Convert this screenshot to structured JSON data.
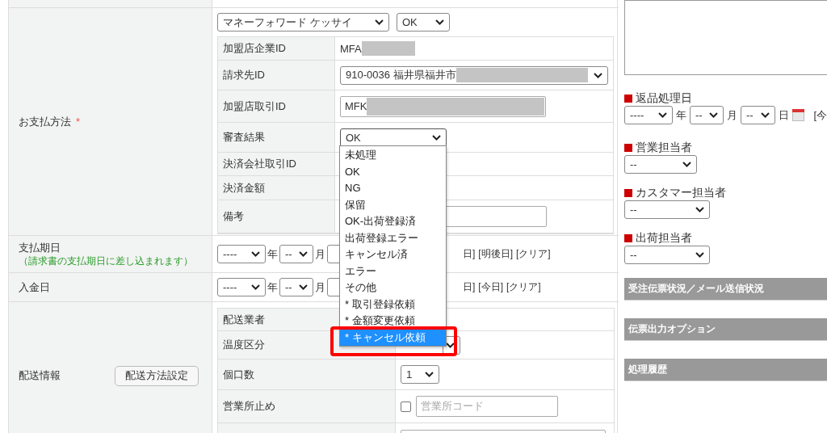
{
  "payment": {
    "label": "お支払方法",
    "required_mark": "*",
    "provider": "マネーフォワード ケッサイ",
    "status": "OK",
    "details": [
      {
        "label": "加盟店企業ID",
        "kind": "text",
        "value": "MFA",
        "redacted": true
      },
      {
        "label": "請求先ID",
        "kind": "select",
        "value": "910-0036 福井県福井市",
        "redacted": true
      },
      {
        "label": "加盟店取引ID",
        "kind": "input",
        "value": "MFK",
        "redacted": true
      },
      {
        "label": "審査結果",
        "kind": "open_select",
        "value": "OK"
      },
      {
        "label": "決済会社取引ID",
        "kind": "empty"
      },
      {
        "label": "決済金額",
        "kind": "empty"
      },
      {
        "label": "備考",
        "kind": "input"
      }
    ]
  },
  "review_dropdown": {
    "options": [
      {
        "label": "未処理",
        "selected": false
      },
      {
        "label": "OK",
        "selected": false
      },
      {
        "label": "NG",
        "selected": false
      },
      {
        "label": "保留",
        "selected": false
      },
      {
        "label": "OK-出荷登録済",
        "selected": false
      },
      {
        "label": "出荷登録エラー",
        "selected": false
      },
      {
        "label": "キャンセル済",
        "selected": false
      },
      {
        "label": "エラー",
        "selected": false
      },
      {
        "label": "その他",
        "selected": false
      },
      {
        "label": "* 取引登録依頼",
        "selected": false
      },
      {
        "label": "* 金額変更依頼",
        "selected": false
      },
      {
        "label": "* キャンセル依頼",
        "selected": true
      }
    ]
  },
  "due_date": {
    "label": "支払期日",
    "note": "（請求書の支払期日に差し込まれます）",
    "year": "----",
    "year_unit": "年",
    "month": "--",
    "month_unit": "月",
    "links": [
      "日]",
      "[明後日]",
      "[クリア]"
    ]
  },
  "deposit_date": {
    "label": "入金日",
    "year": "----",
    "year_unit": "年",
    "month": "--",
    "month_unit": "月",
    "links": [
      "日]",
      "[今日]",
      "[クリア]"
    ]
  },
  "shipping": {
    "label": "配送情報",
    "button": "配送方法設定",
    "details": [
      {
        "label": "配送業者",
        "kind": "covered"
      },
      {
        "label": "温度区分",
        "kind": "covered_select"
      },
      {
        "label": "個口数",
        "kind": "select",
        "value": "1"
      },
      {
        "label": "営業所止め",
        "kind": "checkbox_input",
        "checked": false,
        "placeholder": "営業所コード"
      },
      {
        "kind": "cut_input"
      }
    ]
  },
  "side": {
    "return_date": {
      "label": "返品処理日",
      "year": "----",
      "year_unit": "年",
      "month": "--",
      "month_unit": "月",
      "day": "--",
      "day_unit": "日",
      "link": "[今"
    },
    "assignees": [
      {
        "label": "営業担当者",
        "value": "--"
      },
      {
        "label": "カスタマー担当者",
        "value": "--"
      },
      {
        "label": "出荷担当者",
        "value": "--"
      }
    ],
    "sections": [
      "受注伝票状況／メール送信状況",
      "伝票出力オプション",
      "処理履歴"
    ]
  }
}
